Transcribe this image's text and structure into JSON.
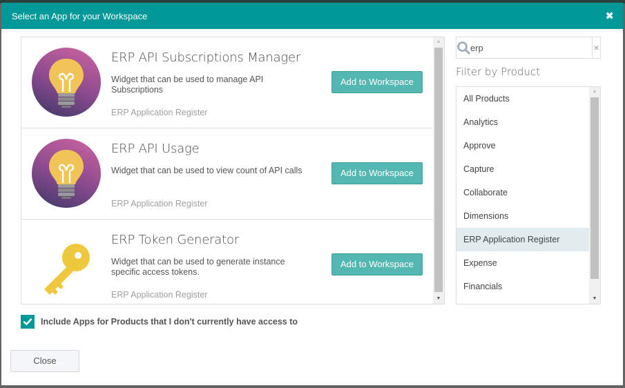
{
  "dialog": {
    "title": "Select an App for your Workspace",
    "close_icon": "close-x-icon"
  },
  "apps": [
    {
      "name": "ERP API Subscriptions Manager",
      "description": "Widget that can be used to manage API Subscriptions",
      "product": "ERP Application Register",
      "icon": "lightbulb-icon",
      "button_label": "Add to Workspace"
    },
    {
      "name": "ERP API Usage",
      "description": "Widget that can be used to view count of API calls",
      "product": "ERP Application Register",
      "icon": "lightbulb-icon",
      "button_label": "Add to Workspace"
    },
    {
      "name": "ERP Token Generator",
      "description": "Widget that can be used to generate instance specific access tokens.",
      "product": "ERP Application Register",
      "icon": "key-icon",
      "button_label": "Add to Workspace"
    }
  ],
  "search": {
    "value": "erp",
    "placeholder": "",
    "clear_label": "×"
  },
  "filter": {
    "label": "Filter by Product",
    "selected": "ERP Application Register",
    "products": [
      "All Products",
      "Analytics",
      "Approve",
      "Capture",
      "Collaborate",
      "Dimensions",
      "ERP Application Register",
      "Expense",
      "Financials"
    ]
  },
  "include_unowned": {
    "checked": true,
    "label": "Include Apps for Products that I don't currently have access to"
  },
  "footer": {
    "close_label": "Close"
  },
  "colors": {
    "header": "#009898",
    "button": "#55b7b1",
    "selected_row": "#e2ecef",
    "bulb_gradient_top": "#c4619e",
    "bulb_gradient_bottom": "#4a3b6b",
    "bulb": "#f0c456",
    "key": "#eec93e"
  }
}
